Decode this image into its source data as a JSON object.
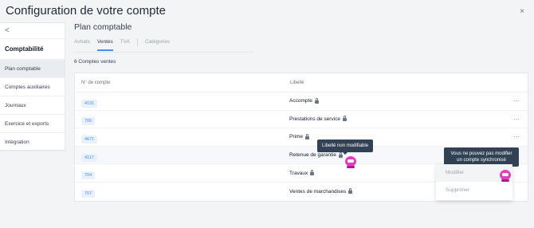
{
  "header": {
    "title": "Configuration de votre compte",
    "close_label": "×"
  },
  "sidebar": {
    "back_label": "<",
    "heading": "Comptabilité",
    "items": [
      {
        "label": "Plan comptable",
        "active": true
      },
      {
        "label": "Comptes auxiliaires",
        "active": false
      },
      {
        "label": "Journaux",
        "active": false
      },
      {
        "label": "Exercice et exports",
        "active": false
      },
      {
        "label": "Intégration",
        "active": false
      }
    ]
  },
  "main": {
    "title": "Plan comptable",
    "tabs": [
      {
        "label": "Achats",
        "active": false
      },
      {
        "label": "Ventes",
        "active": true
      },
      {
        "label": "TVA",
        "active": false
      },
      {
        "label": "Catégories",
        "active": false
      }
    ],
    "count_text": "6 Comptes ventes",
    "table": {
      "headers": [
        "N° de compte",
        "Libellé"
      ],
      "rows": [
        {
          "account": "4191",
          "label": "Accompte",
          "locked": true,
          "menu": "···"
        },
        {
          "account": "706",
          "label": "Prestations de service",
          "locked": true,
          "menu": "···"
        },
        {
          "account": "4671",
          "label": "Prime",
          "locked": true,
          "menu": "···"
        },
        {
          "account": "4117",
          "label": "Retenue de garantie",
          "locked": true,
          "menu": ""
        },
        {
          "account": "704",
          "label": "Travaux",
          "locked": true,
          "menu": ""
        },
        {
          "account": "707",
          "label": "Ventes de marchandises",
          "locked": true,
          "menu": ""
        }
      ]
    }
  },
  "tooltips": {
    "label_locked": "Libellé non modifiable",
    "sync_line1": "Vous ne pouvez pas modifier",
    "sync_line2": "un compte synchronisé"
  },
  "context_menu": {
    "modify": "Modifier",
    "delete": "Supprimer"
  },
  "colors": {
    "accent": "#4a8cf2",
    "tooltip_bg": "#334155",
    "mascot": "#e040c0"
  }
}
